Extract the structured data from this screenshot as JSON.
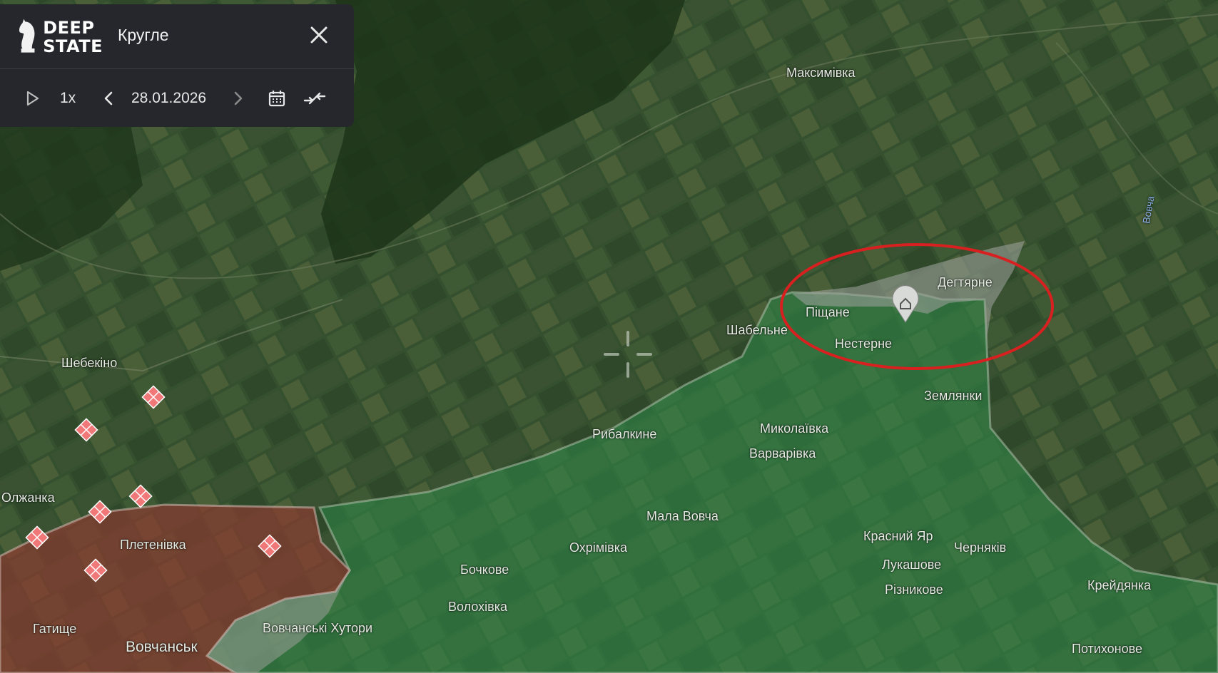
{
  "panel": {
    "logo_line1": "DEEP",
    "logo_line2": "STATE",
    "title": "Кругле",
    "speed": "1x",
    "date": "28.01.2026"
  },
  "icons": [
    "play-icon",
    "chevron-left-icon",
    "chevron-right-icon",
    "calendar-icon",
    "collapse-icon",
    "close-icon",
    "home-marker-icon",
    "crosshair-icon",
    "attack-marker-icon"
  ],
  "colors": {
    "ukraine_controlled": "#2f8a4a",
    "occupied": "#8a3a30",
    "grey_zone": "#9a9e98",
    "highlight_ellipse": "#d82020",
    "panel_bg": "#25272d"
  },
  "map_labels": [
    "Максимівка",
    "Шебекіно",
    "Шабельне",
    "Піщане",
    "Дегтярне",
    "Нестерне",
    "Землянки",
    "Рибалкине",
    "Миколаївка",
    "Варварівка",
    "Олжанка",
    "Плетенівка",
    "Мала Вовча",
    "Охрімівка",
    "Красний Яр",
    "Черняків",
    "Лукашове",
    "Бочкове",
    "Різникове",
    "Крейдянка",
    "Волохівка",
    "Гатище",
    "Вовчанські Хутори",
    "Вовчанськ",
    "Потихонове"
  ],
  "river_label": "Вовча"
}
